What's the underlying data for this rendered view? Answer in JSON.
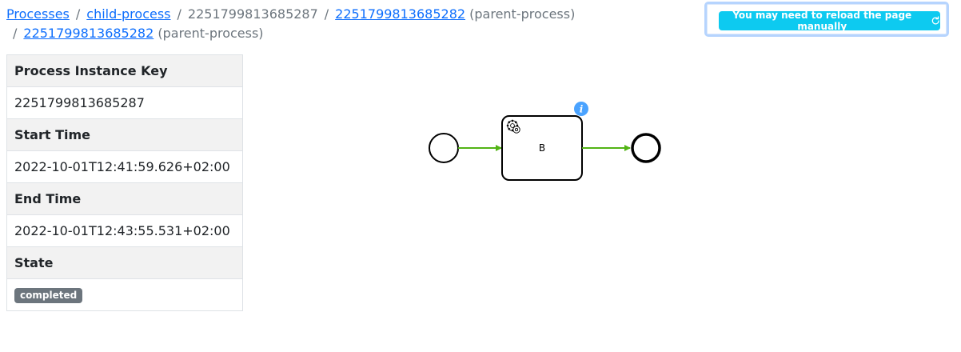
{
  "breadcrumb": {
    "processes": "Processes",
    "child_process": "child-process",
    "current_key": "2251799813685287",
    "parents": [
      {
        "key": "2251799813685282",
        "label": "(parent-process)"
      },
      {
        "key": "2251799813685282",
        "label": "(parent-process)"
      }
    ],
    "separator": "/"
  },
  "notice": {
    "reload_label": "You may need to reload the page manually",
    "reload_icon": "refresh-icon",
    "accent_color": "#0dcaf0"
  },
  "details": {
    "process_instance_key_label": "Process Instance Key",
    "process_instance_key": "2251799813685287",
    "start_time_label": "Start Time",
    "start_time": "2022-10-01T12:41:59.626+02:00",
    "end_time_label": "End Time",
    "end_time": "2022-10-01T12:43:55.531+02:00",
    "state_label": "State",
    "state": "completed"
  },
  "diagram": {
    "task_label": "B",
    "task_icon": "gear-icon",
    "info_icon": "info-icon",
    "flow_color": "#52b415",
    "info_color": "#4aa3ff"
  }
}
